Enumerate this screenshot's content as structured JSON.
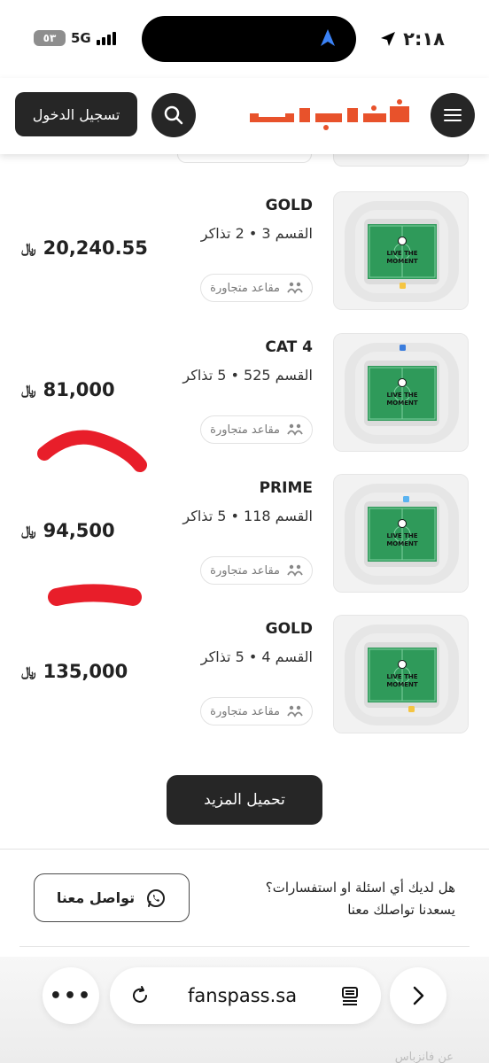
{
  "status_bar": {
    "time": "٢:١٨",
    "network": "5G",
    "battery": "٥٣"
  },
  "header": {
    "logo_text": "فانزباس",
    "login_label": "تسجيل الدخول",
    "brand_color": "#e8522b"
  },
  "listings": [
    {
      "tier": "GOLD",
      "section": "القسم 3",
      "tickets": "2 تذاكر",
      "adjacent": "مقاعد متجاورة",
      "price": "20,240.55",
      "currency": "﷼"
    },
    {
      "tier": "CAT 4",
      "section": "القسم 525",
      "tickets": "5 تذاكر",
      "adjacent": "مقاعد متجاورة",
      "price": "81,000",
      "currency": "﷼"
    },
    {
      "tier": "PRIME",
      "section": "القسم 118",
      "tickets": "5 تذاكر",
      "adjacent": "مقاعد متجاورة",
      "price": "94,500",
      "currency": "﷼"
    },
    {
      "tier": "GOLD",
      "section": "القسم 4",
      "tickets": "5 تذاكر",
      "adjacent": "مقاعد متجاورة",
      "price": "135,000",
      "currency": "﷼"
    }
  ],
  "pitch_text": "LIVE THE MOMENT",
  "load_more_label": "تحميل المزيد",
  "contact": {
    "question": "هل لديك أي اسئلة او استفسارات؟",
    "subtext": "يسعدنا تواصلك معنا",
    "button_label": "تواصل معنا"
  },
  "browser": {
    "url": "fanspass.sa",
    "footer_peek": "عن فانزباس"
  }
}
